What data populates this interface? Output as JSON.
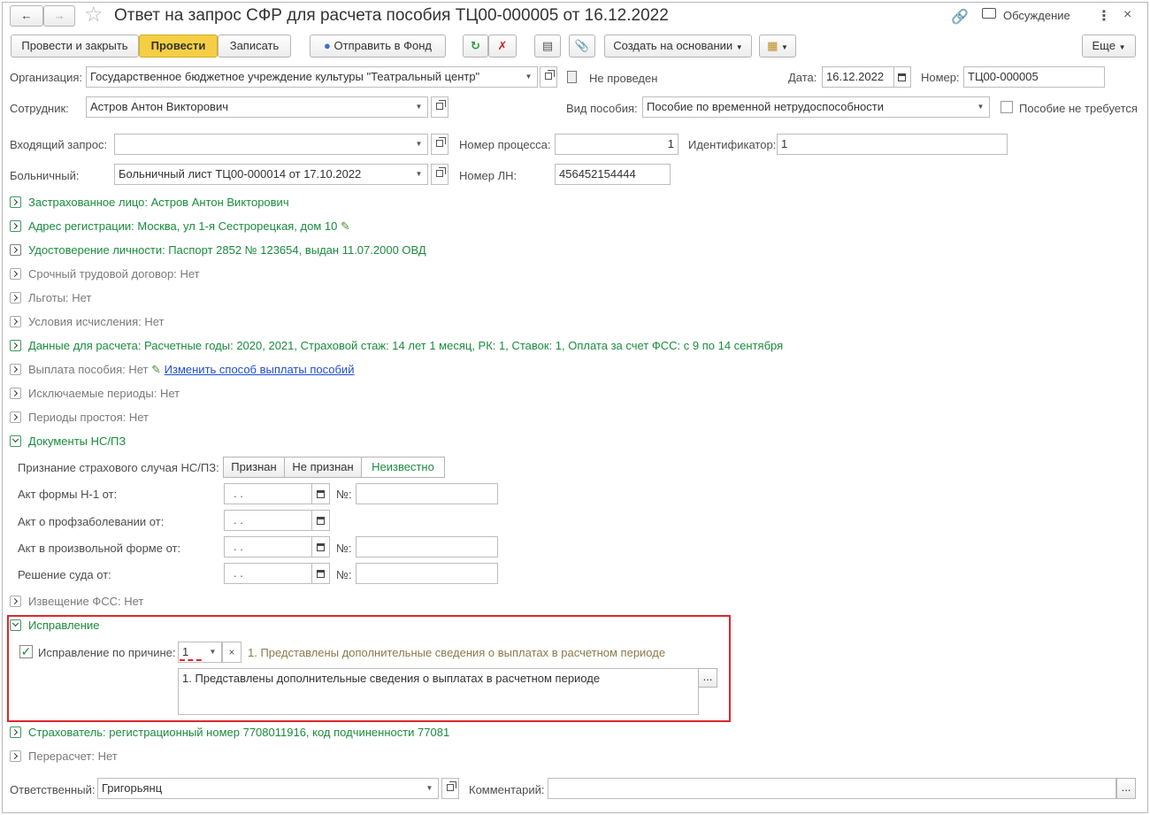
{
  "window": {
    "title": "Ответ на запрос СФР для расчета пособия ТЦ00-000005 от 16.12.2022",
    "discussion_label": "Обсуждение"
  },
  "toolbar": {
    "post_close": "Провести и закрыть",
    "post": "Провести",
    "save": "Записать",
    "send_fund": "Отправить в Фонд",
    "create_based": "Создать на основании",
    "more": "Еще"
  },
  "header": {
    "org_label": "Организация:",
    "org_value": "Государственное бюджетное учреждение культуры \"Театральный центр\"",
    "status": "Не проведен",
    "date_label": "Дата:",
    "date_value": "16.12.2022",
    "number_label": "Номер:",
    "number_value": "ТЦ00-000005",
    "employee_label": "Сотрудник:",
    "employee_value": "Астров Антон Викторович",
    "benefit_type_label": "Вид пособия:",
    "benefit_type_value": "Пособие по временной нетрудоспособности",
    "benefit_not_required": "Пособие не требуется"
  },
  "request": {
    "incoming_label": "Входящий запрос:",
    "incoming_value": "",
    "process_label": "Номер процесса:",
    "process_value": "1",
    "ident_label": "Идентификатор:",
    "ident_value": "1",
    "sick_label": "Больничный:",
    "sick_value": "Больничный лист ТЦ00-000014 от 17.10.2022",
    "ln_label": "Номер ЛН:",
    "ln_value": "456452154444"
  },
  "sections": {
    "insured": "Застрахованное лицо: Астров Антон Викторович",
    "address": "Адрес регистрации: Москва, ул 1-я Сестрорецкая, дом 10",
    "identity": "Удостоверение личности: Паспорт 2852 № 123654, выдан 11.07.2000 ОВД",
    "contract": "Срочный трудовой договор: Нет",
    "benefits": "Льготы: Нет",
    "conditions": "Условия исчисления: Нет",
    "calc_data": "Данные для расчета: Расчетные годы: 2020, 2021, Страховой стаж: 14 лет 1 месяц, РК: 1, Ставок: 1, Оплата за счет ФСС: с 9 по 14 сентября",
    "payment": "Выплата пособия: Нет",
    "payment_link": "Изменить способ выплаты пособий",
    "excluded": "Исключаемые периоды: Нет",
    "downtime": "Периоды простоя: Нет",
    "docs": "Документы НС/ПЗ",
    "notice": "Извещение ФСС: Нет",
    "correction": "Исправление",
    "insurer": "Страхователь: регистрационный номер 7708011916, код подчиненности 77081",
    "recalc": "Перерасчет: Нет"
  },
  "docs": {
    "recognition_label": "Признание страхового случая НС/ПЗ:",
    "seg_yes": "Признан",
    "seg_no": "Не признан",
    "seg_unknown": "Неизвестно",
    "act_n1": "Акт формы Н-1 от:",
    "act_prof": "Акт о профзаболевании от:",
    "act_free": "Акт в произвольной форме от:",
    "court": "Решение суда от:",
    "date_placeholder": " .  .",
    "num_label": "№:"
  },
  "correction": {
    "checkbox_label": "Исправление по причине:",
    "reason_code": "1",
    "reason_text": "1. Представлены дополнительные сведения о выплатах в расчетном периоде",
    "memo": "1. Представлены дополнительные сведения о выплатах в расчетном периоде"
  },
  "footer": {
    "responsible_label": "Ответственный:",
    "responsible_value": "Григорьянц",
    "comment_label": "Комментарий:",
    "comment_value": ""
  },
  "colors": {
    "accent_yellow": "#f5cf43",
    "section_green": "#1a8c3e",
    "link_blue": "#1f4ecb",
    "highlight_red": "#d9282d"
  }
}
